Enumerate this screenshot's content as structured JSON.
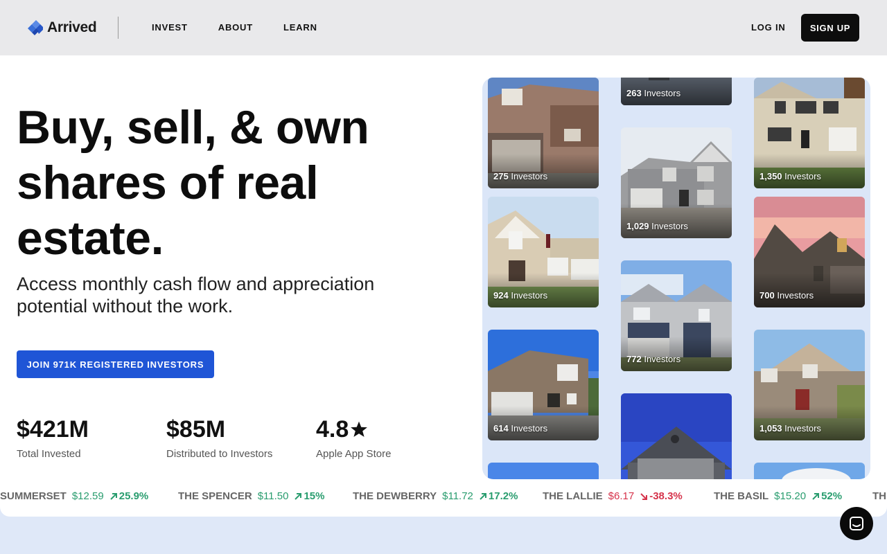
{
  "header": {
    "brand": "Arrived",
    "nav": [
      "INVEST",
      "ABOUT",
      "LEARN"
    ],
    "login_label": "LOG IN",
    "signup_label": "SIGN UP"
  },
  "hero": {
    "headline": "Buy, sell, & own shares of real estate.",
    "subhead": "Access monthly cash flow and appreciation potential without the work.",
    "cta_label": "JOIN 971K REGISTERED INVESTORS"
  },
  "stats": [
    {
      "value": "$421M",
      "label": "Total Invested"
    },
    {
      "value": "$85M",
      "label": "Distributed to Investors"
    },
    {
      "value": "4.8",
      "label": "Apple App Store",
      "icon": "star-icon"
    }
  ],
  "properties": [
    {
      "count": "275",
      "label": "Investors"
    },
    {
      "count": "263",
      "label": "Investors"
    },
    {
      "count": "1,350",
      "label": "Investors"
    },
    {
      "count": "1,029",
      "label": "Investors"
    },
    {
      "count": "924",
      "label": "Investors"
    },
    {
      "count": "700",
      "label": "Investors"
    },
    {
      "count": "772",
      "label": "Investors"
    },
    {
      "count": "614",
      "label": "Investors"
    },
    {
      "count": "1,053",
      "label": "Investors"
    }
  ],
  "ticker": [
    {
      "name": "SUMMERSET",
      "price": "$12.59",
      "change": "25.9%",
      "direction": "up"
    },
    {
      "name": "THE SPENCER",
      "price": "$11.50",
      "change": "15%",
      "direction": "up"
    },
    {
      "name": "THE DEWBERRY",
      "price": "$11.72",
      "change": "17.2%",
      "direction": "up"
    },
    {
      "name": "THE LALLIE",
      "price": "$6.17",
      "change": "-38.3%",
      "direction": "down"
    },
    {
      "name": "THE BASIL",
      "price": "$15.20",
      "change": "52%",
      "direction": "up"
    },
    {
      "name": "TH",
      "price": "",
      "change": "",
      "direction": "up"
    }
  ],
  "colors": {
    "accent": "#1f55d6",
    "up": "#2a9d6f",
    "down": "#d6334b"
  }
}
